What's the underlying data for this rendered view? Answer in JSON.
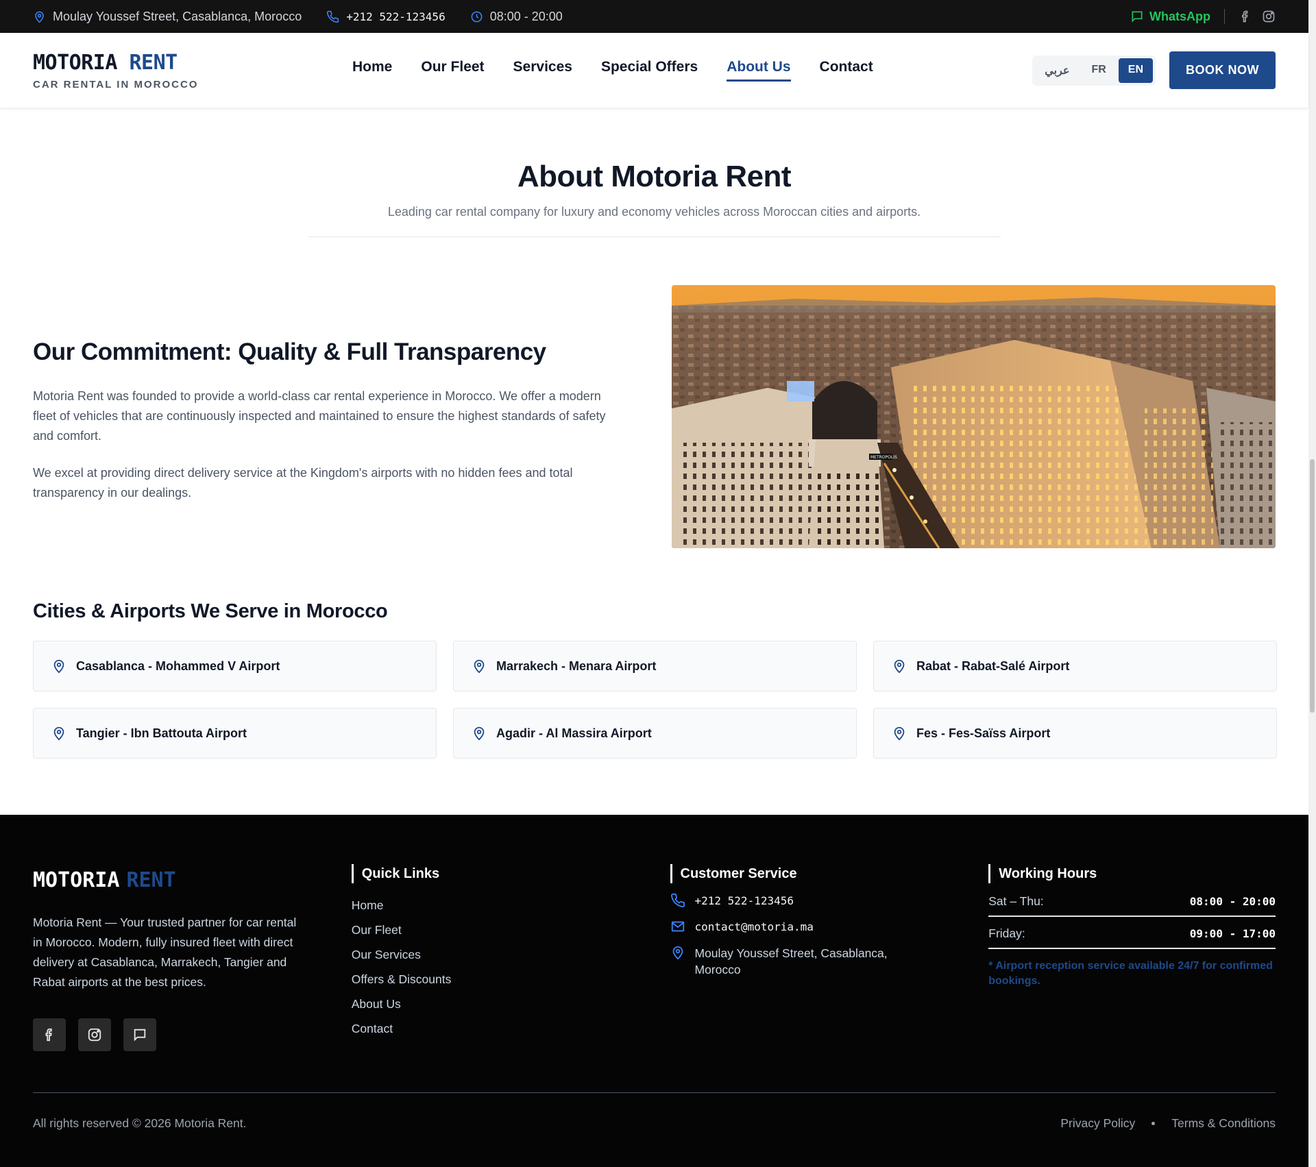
{
  "topbar": {
    "address": "Moulay Youssef Street, Casablanca, Morocco",
    "phone": "+212 522-123456",
    "hours": "08:00 - 20:00",
    "whatsapp": "WhatsApp",
    "icons": [
      "location-pin-icon",
      "phone-icon",
      "clock-icon",
      "chat-icon",
      "facebook-icon",
      "instagram-icon"
    ]
  },
  "header": {
    "logo_main": "MOTORIA",
    "logo_accent": "RENT",
    "tagline": "CAR RENTAL IN MOROCCO",
    "nav": [
      "Home",
      "Our Fleet",
      "Services",
      "Special Offers",
      "About Us",
      "Contact"
    ],
    "active_nav": "About Us",
    "languages": [
      "عربي",
      "FR",
      "EN"
    ],
    "active_language": "EN",
    "book_label": "BOOK NOW"
  },
  "hero": {
    "title": "About Motoria Rent",
    "subtitle": "Leading car rental company for luxury and economy vehicles across Moroccan cities and airports."
  },
  "commitment": {
    "title": "Our Commitment: Quality & Full Transparency",
    "para1": "Motoria Rent was founded to provide a world-class car rental experience in Morocco. We offer a modern fleet of vehicles that are continuously inspected and maintained to ensure the highest standards of safety and comfort.",
    "para2": "We excel at providing direct delivery service at the Kingdom's airports with no hidden fees and total transparency in our dealings.",
    "image_sign": "METROPOLIS"
  },
  "cities": {
    "title": "Cities & Airports We Serve in Morocco",
    "items": [
      "Casablanca - Mohammed V Airport",
      "Marrakech - Menara Airport",
      "Rabat - Rabat-Salé Airport",
      "Tangier - Ibn Battouta Airport",
      "Agadir - Al Massira Airport",
      "Fes - Fes-Saïss Airport"
    ]
  },
  "footer": {
    "logo_main": "MOTORIA",
    "logo_accent": "RENT",
    "description": "Motoria Rent — Your trusted partner for car rental in Morocco. Modern, fully insured fleet with direct delivery at Casablanca, Marrakech, Tangier and Rabat airports at the best prices.",
    "quick_links_title": "Quick Links",
    "quick_links": [
      "Home",
      "Our Fleet",
      "Our Services",
      "Offers & Discounts",
      "About Us",
      "Contact"
    ],
    "service_title": "Customer Service",
    "phone": "+212 522-123456",
    "email": "contact@motoria.ma",
    "address": "Moulay Youssef Street, Casablanca, Morocco",
    "hours_title": "Working Hours",
    "hours": [
      {
        "day": "Sat – Thu:",
        "time": "08:00 - 20:00"
      },
      {
        "day": "Friday:",
        "time": "09:00 - 17:00"
      }
    ],
    "hours_note": "* Airport reception service available 24/7 for confirmed bookings.",
    "copyright": "All rights reserved © 2026 Motoria Rent.",
    "privacy": "Privacy Policy",
    "terms": "Terms & Conditions"
  },
  "colors": {
    "brand": "#1e4a8c",
    "topbar_bg": "#131313",
    "footer_bg": "#050505",
    "whatsapp": "#22c55e"
  }
}
